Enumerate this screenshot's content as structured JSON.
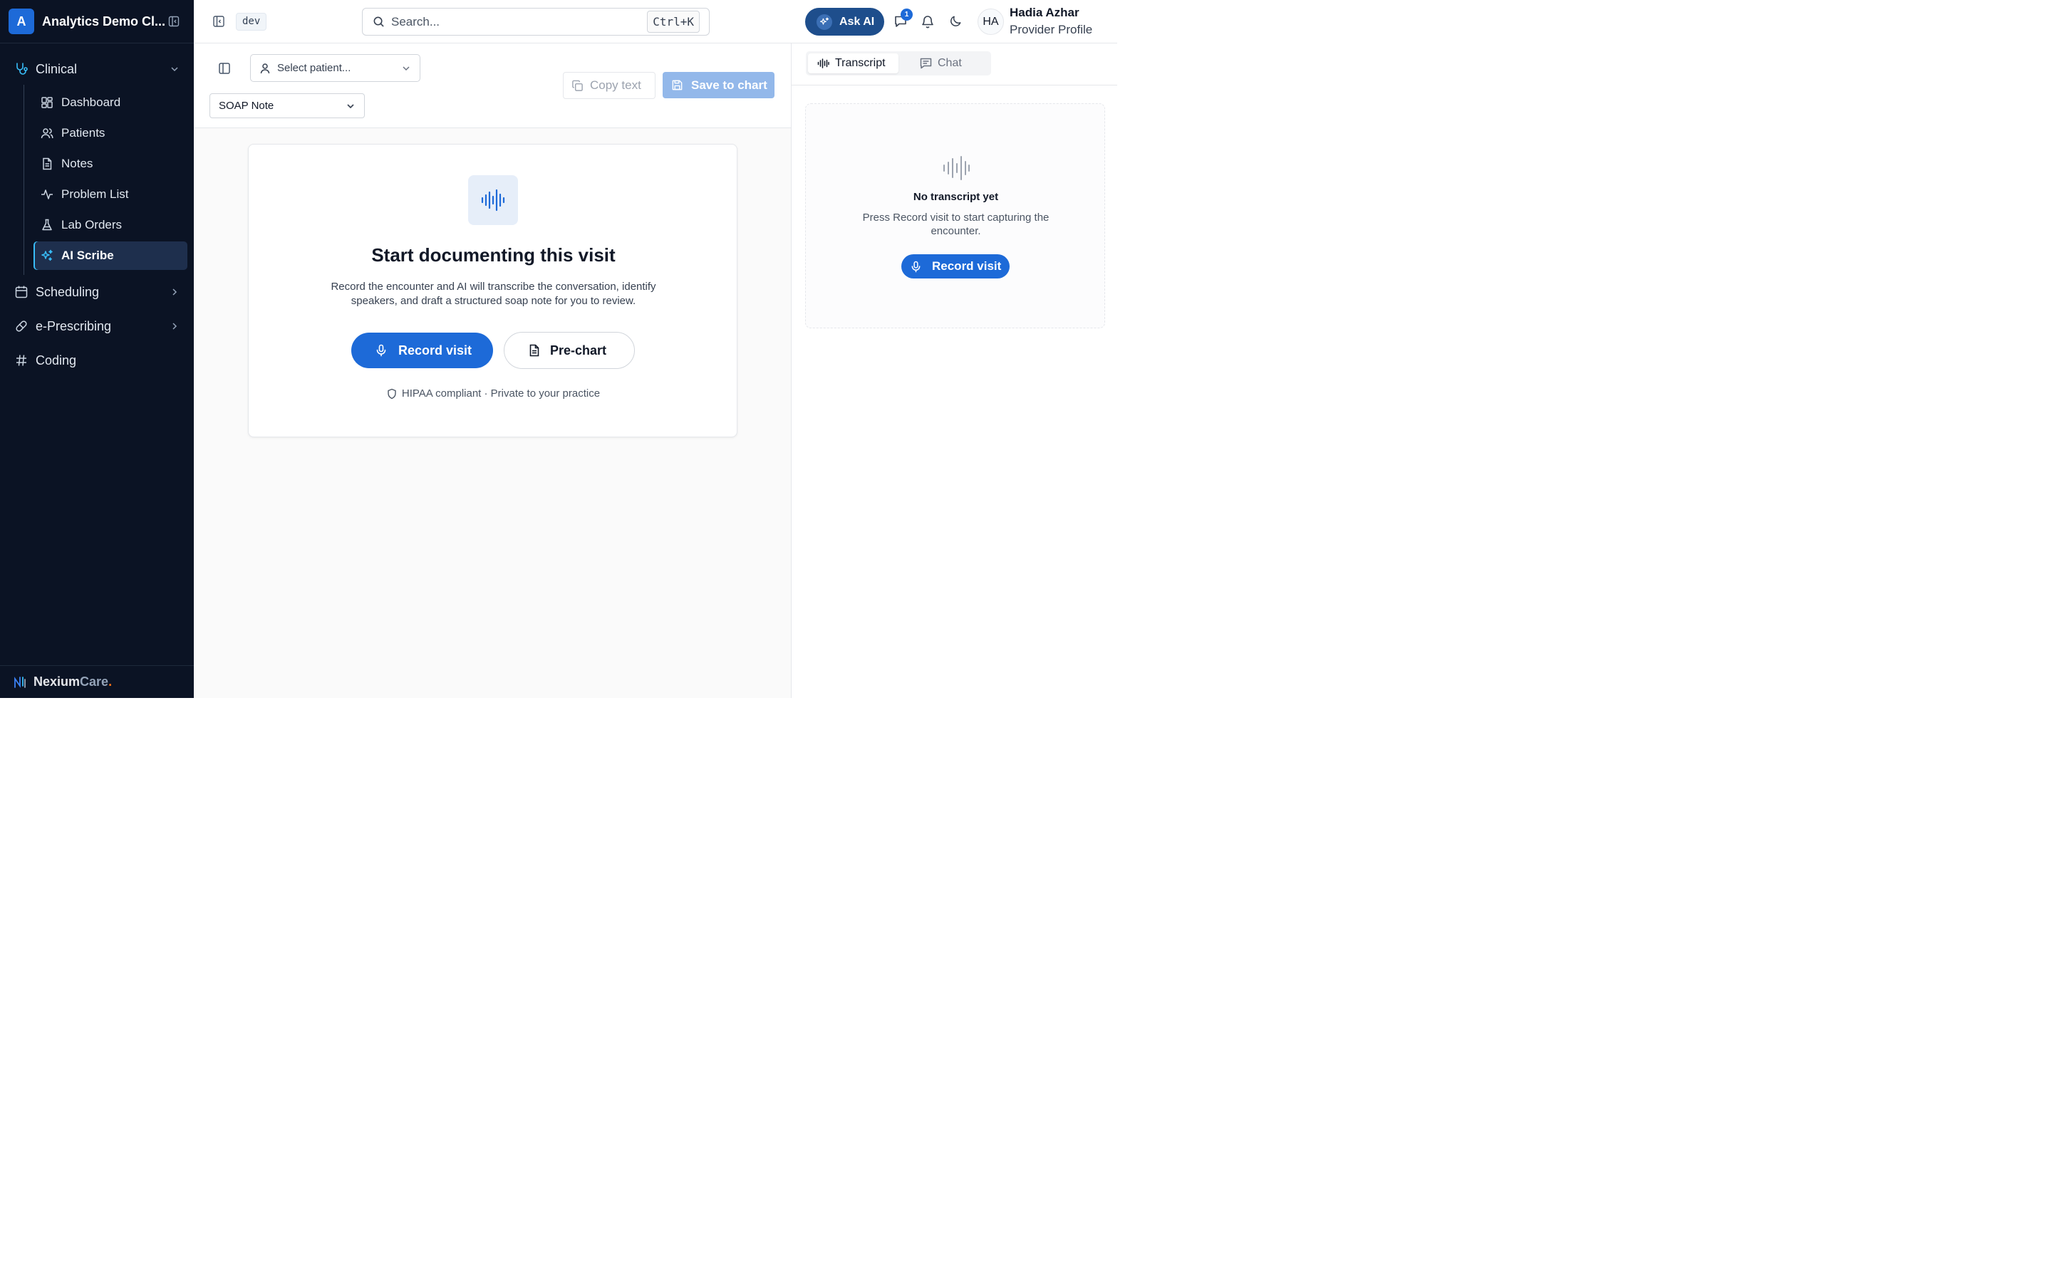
{
  "sidebar": {
    "org_initial": "A",
    "org_name": "Analytics Demo Cl...",
    "groups": [
      {
        "label": "Clinical",
        "icon": "stethoscope-icon",
        "expanded": true
      },
      {
        "label": "Scheduling",
        "icon": "calendar-icon",
        "expanded": false
      },
      {
        "label": "e-Prescribing",
        "icon": "pill-icon",
        "expanded": false
      },
      {
        "label": "Coding",
        "icon": "hash-icon"
      }
    ],
    "clinical_items": [
      {
        "label": "Dashboard",
        "icon": "dashboard-icon"
      },
      {
        "label": "Patients",
        "icon": "users-icon"
      },
      {
        "label": "Notes",
        "icon": "document-icon"
      },
      {
        "label": "Problem List",
        "icon": "activity-icon"
      },
      {
        "label": "Lab Orders",
        "icon": "flask-icon"
      },
      {
        "label": "AI Scribe",
        "icon": "sparkles-icon",
        "active": true
      }
    ],
    "brand": {
      "part1": "Nexium",
      "part2": "Care",
      "dot": "."
    }
  },
  "topbar": {
    "env": "dev",
    "search_placeholder": "Search...",
    "shortcut": "Ctrl+K",
    "ask_ai": "Ask AI",
    "message_count": "1",
    "user_initials": "HA",
    "user_name": "Hadia Azhar",
    "user_role": "Provider Profile"
  },
  "main": {
    "patient_placeholder": "Select patient...",
    "note_type": "SOAP Note",
    "copy_label": "Copy text",
    "save_label": "Save to chart",
    "card": {
      "title": "Start documenting this visit",
      "description": "Record the encounter and AI will transcribe the conversation, identify speakers, and draft a structured soap note for you to review.",
      "record_label": "Record visit",
      "prechart_label": "Pre-chart",
      "compliance": "HIPAA compliant · Private to your practice"
    }
  },
  "right_panel": {
    "tabs": [
      {
        "label": "Transcript",
        "icon": "waveform-icon",
        "active": true
      },
      {
        "label": "Chat",
        "icon": "chat-icon",
        "active": false
      }
    ],
    "empty_title": "No transcript yet",
    "empty_desc": "Press Record visit to start capturing the encounter.",
    "record_label": "Record visit"
  },
  "colors": {
    "sidebar_bg": "#0b1324",
    "accent": "#1d6ad8",
    "active_accent": "#38bdf8",
    "save_disabled": "#93b8ea",
    "brand_dot": "#f97316"
  }
}
